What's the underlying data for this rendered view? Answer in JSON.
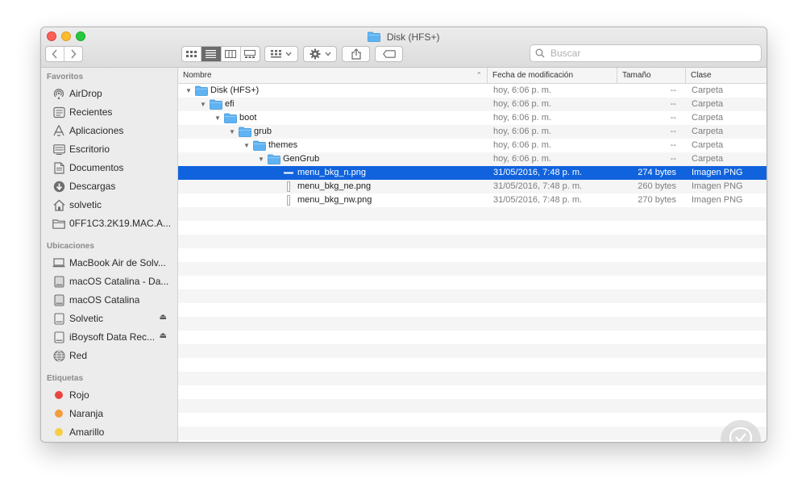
{
  "window": {
    "title": "Disk (HFS+)"
  },
  "toolbar": {
    "search_placeholder": "Buscar"
  },
  "sidebar": {
    "sections": {
      "favorites": "Favoritos",
      "locations": "Ubicaciones",
      "tags": "Etiquetas"
    },
    "favorites": [
      {
        "label": "AirDrop",
        "icon": "airdrop-icon"
      },
      {
        "label": "Recientes",
        "icon": "clock-icon"
      },
      {
        "label": "Aplicaciones",
        "icon": "applications-icon"
      },
      {
        "label": "Escritorio",
        "icon": "desktop-icon"
      },
      {
        "label": "Documentos",
        "icon": "document-icon"
      },
      {
        "label": "Descargas",
        "icon": "download-icon"
      },
      {
        "label": "solvetic",
        "icon": "home-icon"
      },
      {
        "label": "0FF1C3.2K19.MAC.A...",
        "icon": "folder-icon"
      }
    ],
    "locations": [
      {
        "label": "MacBook Air de Solv...",
        "icon": "laptop-icon"
      },
      {
        "label": "macOS Catalina - Da...",
        "icon": "disk-icon"
      },
      {
        "label": "macOS Catalina",
        "icon": "disk-icon"
      },
      {
        "label": "Solvetic",
        "icon": "external-disk-icon"
      },
      {
        "label": "iBoysoft Data Rec...",
        "icon": "external-disk-icon"
      },
      {
        "label": "Red",
        "icon": "network-icon"
      }
    ],
    "tags": [
      {
        "label": "Rojo",
        "color": "#e8473f"
      },
      {
        "label": "Naranja",
        "color": "#f49c3c"
      },
      {
        "label": "Amarillo",
        "color": "#f7cd46"
      }
    ]
  },
  "columns": {
    "name": "Nombre",
    "date": "Fecha de modificación",
    "size": "Tamaño",
    "kind": "Clase"
  },
  "files": [
    {
      "name": "Disk (HFS+)",
      "date": "hoy, 6:06 p. m.",
      "size": "--",
      "kind": "Carpeta",
      "type": "folder",
      "level": 0
    },
    {
      "name": "efi",
      "date": "hoy, 6:06 p. m.",
      "size": "--",
      "kind": "Carpeta",
      "type": "folder",
      "level": 1
    },
    {
      "name": "boot",
      "date": "hoy, 6:06 p. m.",
      "size": "--",
      "kind": "Carpeta",
      "type": "folder",
      "level": 2
    },
    {
      "name": "grub",
      "date": "hoy, 6:06 p. m.",
      "size": "--",
      "kind": "Carpeta",
      "type": "folder",
      "level": 3
    },
    {
      "name": "themes",
      "date": "hoy, 6:06 p. m.",
      "size": "--",
      "kind": "Carpeta",
      "type": "folder",
      "level": 4
    },
    {
      "name": "GenGrub",
      "date": "hoy, 6:06 p. m.",
      "size": "--",
      "kind": "Carpeta",
      "type": "folder",
      "level": 5
    },
    {
      "name": "menu_bkg_n.png",
      "date": "31/05/2016, 7:48 p. m.",
      "size": "274 bytes",
      "kind": "Imagen PNG",
      "type": "image",
      "level": 6,
      "selected": true
    },
    {
      "name": "menu_bkg_ne.png",
      "date": "31/05/2016, 7:48 p. m.",
      "size": "260 bytes",
      "kind": "Imagen PNG",
      "type": "image",
      "level": 6
    },
    {
      "name": "menu_bkg_nw.png",
      "date": "31/05/2016, 7:48 p. m.",
      "size": "270 bytes",
      "kind": "Imagen PNG",
      "type": "image",
      "level": 6
    }
  ],
  "colors": {
    "selection": "#1063dd",
    "folder": "#5fb3f2"
  }
}
